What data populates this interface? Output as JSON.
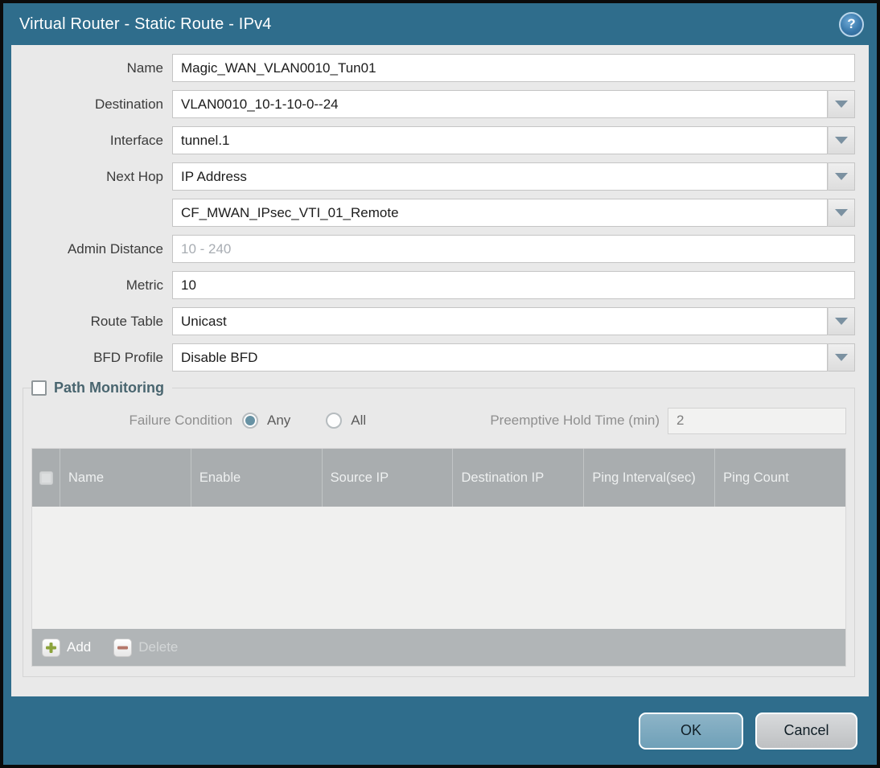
{
  "window": {
    "title": "Virtual Router - Static Route - IPv4",
    "help_icon": "?"
  },
  "form": {
    "name": {
      "label": "Name",
      "value": "Magic_WAN_VLAN0010_Tun01"
    },
    "destination": {
      "label": "Destination",
      "value": "VLAN0010_10-1-10-0--24"
    },
    "interface": {
      "label": "Interface",
      "value": "tunnel.1"
    },
    "next_hop": {
      "label": "Next Hop",
      "value": "IP Address"
    },
    "next_hop_address": {
      "value": "CF_MWAN_IPsec_VTI_01_Remote"
    },
    "admin_distance": {
      "label": "Admin Distance",
      "value": "",
      "placeholder": "10 - 240"
    },
    "metric": {
      "label": "Metric",
      "value": "10"
    },
    "route_table": {
      "label": "Route Table",
      "value": "Unicast"
    },
    "bfd_profile": {
      "label": "BFD Profile",
      "value": "Disable BFD"
    }
  },
  "path_monitoring": {
    "title": "Path Monitoring",
    "checked": false,
    "failure_condition": {
      "label": "Failure Condition",
      "options": [
        "Any",
        "All"
      ],
      "selected": "Any"
    },
    "preemptive_hold_time": {
      "label": "Preemptive Hold Time (min)",
      "value": "2"
    },
    "table": {
      "columns": [
        "Name",
        "Enable",
        "Source IP",
        "Destination IP",
        "Ping Interval(sec)",
        "Ping Count"
      ],
      "rows": []
    },
    "buttons": {
      "add": "Add",
      "delete": "Delete"
    }
  },
  "footer": {
    "ok": "OK",
    "cancel": "Cancel"
  },
  "colors": {
    "frame_teal": "#2f6d8c",
    "content_bg": "#e9e9e9",
    "table_header_bg": "#a9adaf",
    "ok_button_bg": "#7da9be",
    "radio_selected": "#6792a4",
    "add_icon_green": "#8ca33c",
    "delete_icon_red": "#b5776a"
  }
}
